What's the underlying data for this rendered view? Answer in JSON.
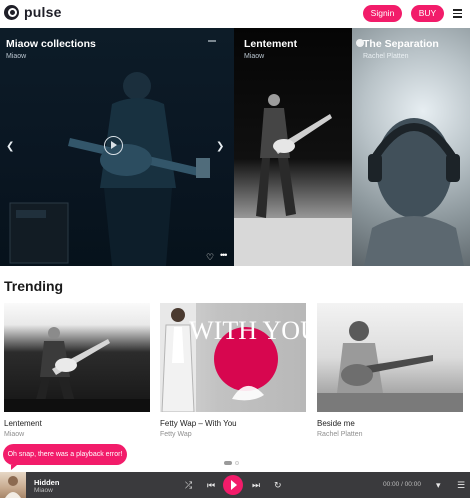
{
  "header": {
    "brand": "pulse",
    "signin_label": "Signin",
    "buy_label": "BUY"
  },
  "hero": {
    "slides": [
      {
        "title": "Miaow collections",
        "subtitle": "Miaow"
      },
      {
        "title": "Lentement",
        "subtitle": "Miaow"
      },
      {
        "title": "The Separation",
        "subtitle": "Rachel Platten"
      }
    ]
  },
  "trending": {
    "title": "Trending",
    "cards": [
      {
        "title": "Lentement",
        "artist": "Miaow"
      },
      {
        "title": "Fetty Wap – With You",
        "artist": "Fetty Wap",
        "image_text": "WITH YOU"
      },
      {
        "title": "Beside me",
        "artist": "Rachel Platten"
      }
    ]
  },
  "toast": {
    "message": "Oh snap, there was a playback error!"
  },
  "player": {
    "title": "Hidden",
    "artist": "Miaow",
    "time": "00:00 / 00:00"
  },
  "colors": {
    "accent": "#f21c6a",
    "player_bg": "#3a3a3d"
  }
}
